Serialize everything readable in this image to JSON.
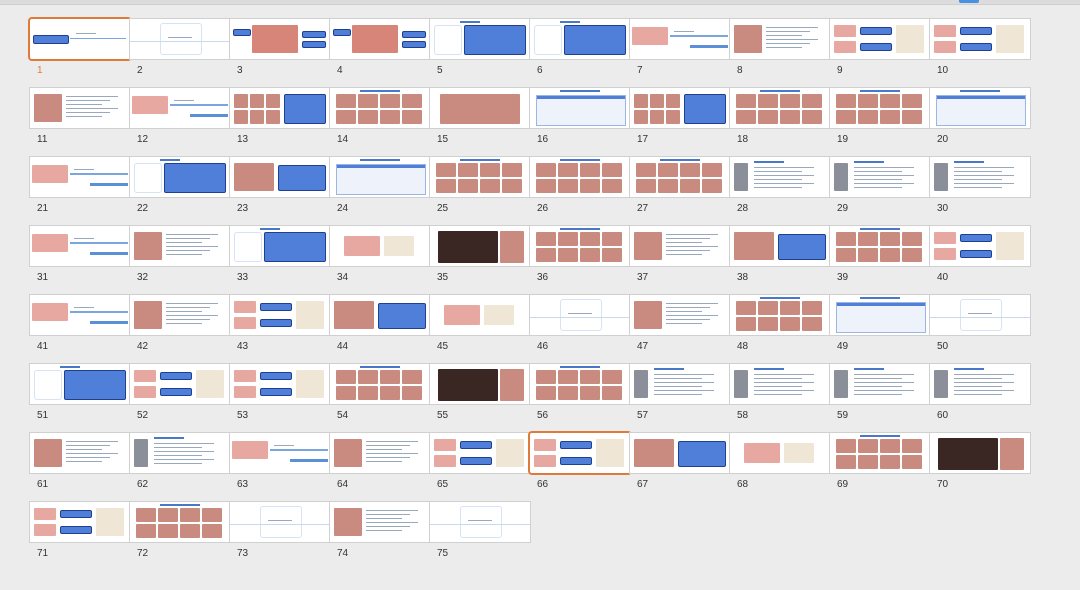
{
  "window": {
    "accent_color": "#4a90e2",
    "selection_color": "#e07a3a",
    "current_slide": 1,
    "selected_slide": 66
  },
  "slides": [
    {
      "number": "1",
      "layout": "title-banner"
    },
    {
      "number": "2",
      "layout": "diagram-faint"
    },
    {
      "number": "3",
      "layout": "tooth-diagram"
    },
    {
      "number": "4",
      "layout": "tooth-diagram"
    },
    {
      "number": "5",
      "layout": "diagram-box"
    },
    {
      "number": "6",
      "layout": "diagram-box"
    },
    {
      "number": "7",
      "layout": "section-photo"
    },
    {
      "number": "8",
      "layout": "photo-text"
    },
    {
      "number": "9",
      "layout": "photo-boxes"
    },
    {
      "number": "10",
      "layout": "photo-boxes"
    },
    {
      "number": "11",
      "layout": "photo-text"
    },
    {
      "number": "12",
      "layout": "section-photo"
    },
    {
      "number": "13",
      "layout": "photo-grid-box"
    },
    {
      "number": "14",
      "layout": "photo-grid"
    },
    {
      "number": "15",
      "layout": "photo-large"
    },
    {
      "number": "16",
      "layout": "table"
    },
    {
      "number": "17",
      "layout": "photo-grid-box"
    },
    {
      "number": "18",
      "layout": "photo-grid"
    },
    {
      "number": "19",
      "layout": "photo-grid"
    },
    {
      "number": "20",
      "layout": "table"
    },
    {
      "number": "21",
      "layout": "section-photo"
    },
    {
      "number": "22",
      "layout": "diagram-box"
    },
    {
      "number": "23",
      "layout": "photo-box"
    },
    {
      "number": "24",
      "layout": "table"
    },
    {
      "number": "25",
      "layout": "photo-grid"
    },
    {
      "number": "26",
      "layout": "photo-grid"
    },
    {
      "number": "27",
      "layout": "photo-grid"
    },
    {
      "number": "28",
      "layout": "text-small"
    },
    {
      "number": "29",
      "layout": "text-small"
    },
    {
      "number": "30",
      "layout": "text-small"
    },
    {
      "number": "31",
      "layout": "section-photo"
    },
    {
      "number": "32",
      "layout": "photo-text"
    },
    {
      "number": "33",
      "layout": "diagram-box"
    },
    {
      "number": "34",
      "layout": "photo-small"
    },
    {
      "number": "35",
      "layout": "photo-dark"
    },
    {
      "number": "36",
      "layout": "photo-grid"
    },
    {
      "number": "37",
      "layout": "photo-text"
    },
    {
      "number": "38",
      "layout": "photo-box"
    },
    {
      "number": "39",
      "layout": "photo-grid"
    },
    {
      "number": "40",
      "layout": "photo-boxes"
    },
    {
      "number": "41",
      "layout": "section-photo"
    },
    {
      "number": "42",
      "layout": "photo-text"
    },
    {
      "number": "43",
      "layout": "photo-boxes"
    },
    {
      "number": "44",
      "layout": "photo-box"
    },
    {
      "number": "45",
      "layout": "photo-small"
    },
    {
      "number": "46",
      "layout": "diagram-faint"
    },
    {
      "number": "47",
      "layout": "photo-text"
    },
    {
      "number": "48",
      "layout": "photo-grid"
    },
    {
      "number": "49",
      "layout": "table"
    },
    {
      "number": "50",
      "layout": "diagram-faint"
    },
    {
      "number": "51",
      "layout": "diagram-box"
    },
    {
      "number": "52",
      "layout": "photo-boxes"
    },
    {
      "number": "53",
      "layout": "photo-boxes"
    },
    {
      "number": "54",
      "layout": "photo-grid"
    },
    {
      "number": "55",
      "layout": "photo-dark"
    },
    {
      "number": "56",
      "layout": "photo-grid"
    },
    {
      "number": "57",
      "layout": "text-small"
    },
    {
      "number": "58",
      "layout": "text-small"
    },
    {
      "number": "59",
      "layout": "text-small"
    },
    {
      "number": "60",
      "layout": "text-small"
    },
    {
      "number": "61",
      "layout": "photo-text"
    },
    {
      "number": "62",
      "layout": "text-small"
    },
    {
      "number": "63",
      "layout": "section-photo"
    },
    {
      "number": "64",
      "layout": "photo-text"
    },
    {
      "number": "65",
      "layout": "photo-boxes"
    },
    {
      "number": "66",
      "layout": "photo-boxes"
    },
    {
      "number": "67",
      "layout": "photo-box"
    },
    {
      "number": "68",
      "layout": "photo-small"
    },
    {
      "number": "69",
      "layout": "photo-grid"
    },
    {
      "number": "70",
      "layout": "photo-dark"
    },
    {
      "number": "71",
      "layout": "photo-boxes"
    },
    {
      "number": "72",
      "layout": "photo-grid"
    },
    {
      "number": "73",
      "layout": "diagram-faint"
    },
    {
      "number": "74",
      "layout": "photo-text"
    },
    {
      "number": "75",
      "layout": "diagram-faint"
    }
  ]
}
